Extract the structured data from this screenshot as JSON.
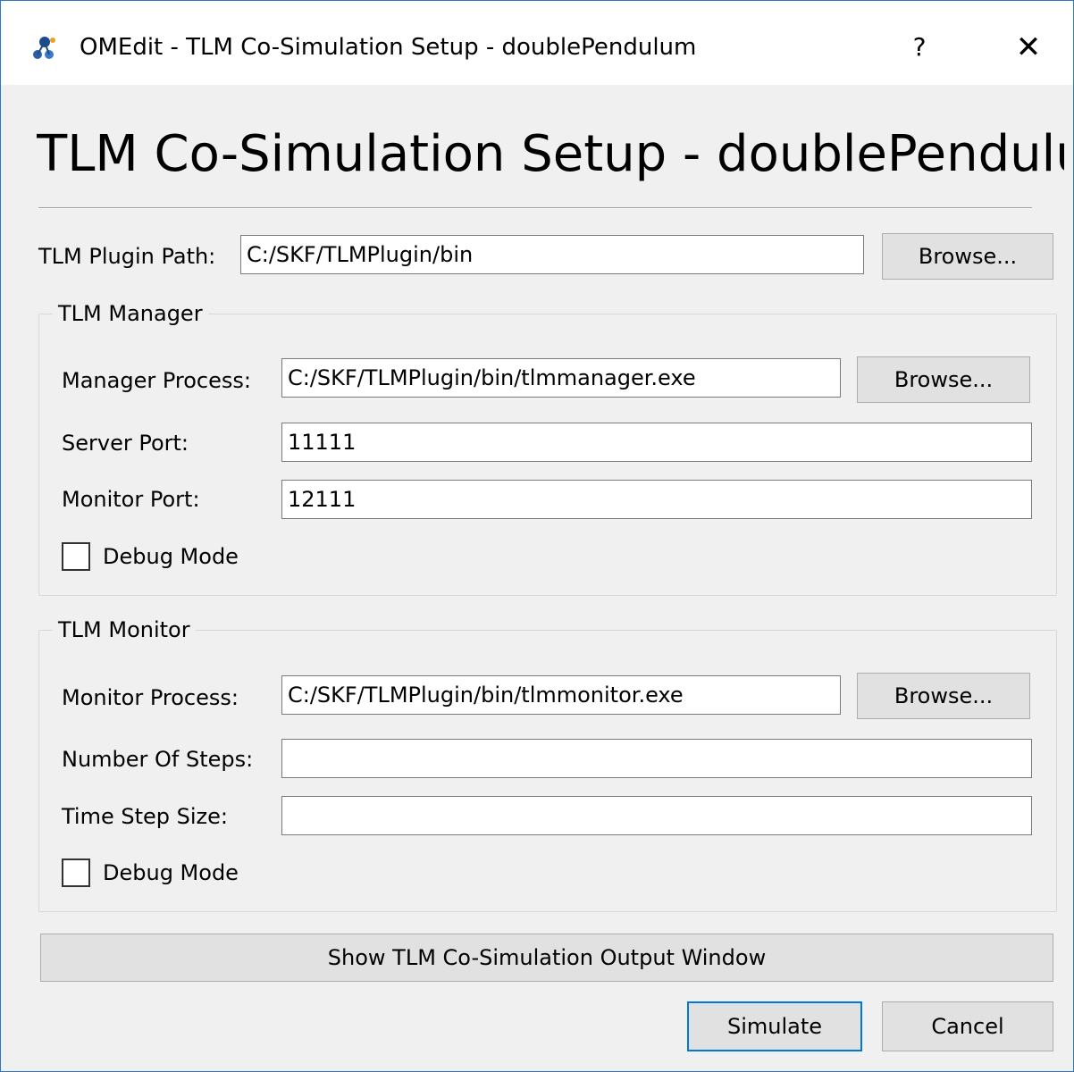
{
  "window": {
    "title": "OMEdit - TLM Co-Simulation Setup - doublePendulum",
    "help_label": "?",
    "close_label": "✕",
    "icon": "omedit-app-icon"
  },
  "heading": "TLM Co-Simulation Setup - doublePendulum",
  "plugin_path": {
    "label": "TLM Plugin Path:",
    "value": "C:/SKF/TLMPlugin/bin",
    "browse_label": "Browse..."
  },
  "manager": {
    "group_title": "TLM Manager",
    "process_label": "Manager Process:",
    "process_value": "C:/SKF/TLMPlugin/bin/tlmmanager.exe",
    "browse_label": "Browse...",
    "server_port_label": "Server Port:",
    "server_port_value": "11111",
    "monitor_port_label": "Monitor Port:",
    "monitor_port_value": "12111",
    "debug_label": "Debug Mode",
    "debug_checked": false
  },
  "monitor": {
    "group_title": "TLM Monitor",
    "process_label": "Monitor Process:",
    "process_value": "C:/SKF/TLMPlugin/bin/tlmmonitor.exe",
    "browse_label": "Browse...",
    "steps_label": "Number Of Steps:",
    "steps_value": "",
    "time_step_label": "Time Step Size:",
    "time_step_value": "",
    "debug_label": "Debug Mode",
    "debug_checked": false
  },
  "buttons": {
    "show_output_label": "Show TLM Co-Simulation Output Window",
    "simulate_label": "Simulate",
    "cancel_label": "Cancel"
  },
  "colors": {
    "window_border": "#2b78c5",
    "dialog_bg": "#f0f0f0",
    "default_button_border": "#0078d7"
  }
}
